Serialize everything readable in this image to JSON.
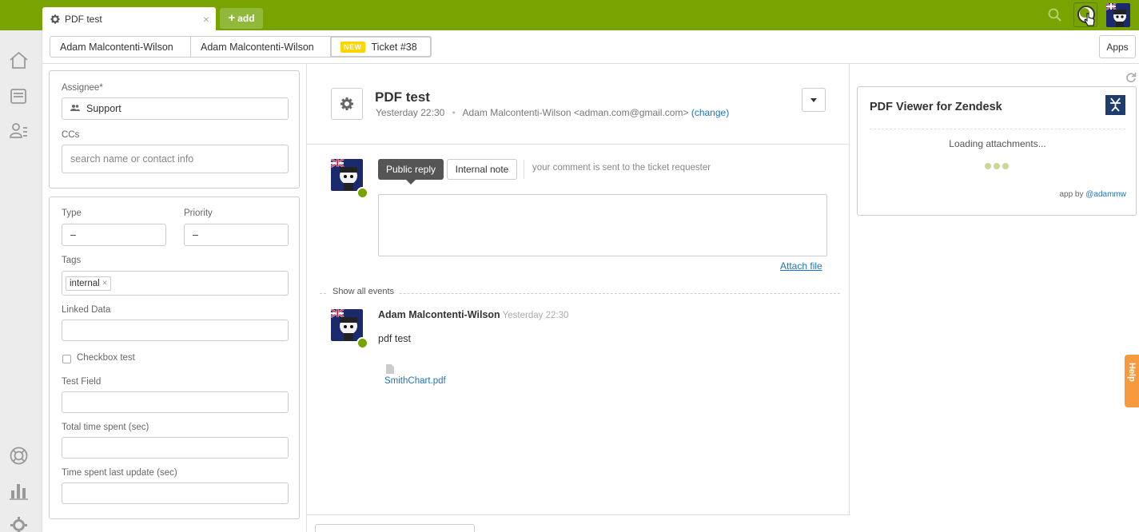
{
  "topbar": {
    "tab_title": "PDF test",
    "tab_close": "×",
    "add_label": "add",
    "add_plus": "+",
    "icons": [
      "search-icon",
      "status-avatar-icon",
      "user-avatar-icon"
    ],
    "color": "#78a300"
  },
  "leftnav": {
    "icons": [
      "home-icon",
      "views-icon",
      "customers-icon",
      "help-center-icon",
      "reporting-icon",
      "admin-gear-icon"
    ]
  },
  "breadcrumbs": {
    "items": [
      "Adam Malcontenti-Wilson",
      "Adam Malcontenti-Wilson"
    ],
    "new_badge": "NEW",
    "ticket": "Ticket #38"
  },
  "apps_button": "Apps",
  "properties": {
    "assignee_label": "Assignee*",
    "assignee_value": "Support",
    "ccs_label": "CCs",
    "ccs_placeholder": "search name or contact info",
    "type_label": "Type",
    "type_value": "–",
    "priority_label": "Priority",
    "priority_value": "–",
    "tags_label": "Tags",
    "tag": "internal",
    "tag_remove": "×",
    "linked_data_label": "Linked Data",
    "checkbox_label": "Checkbox test",
    "test_field_label": "Test Field",
    "total_time_label": "Total time spent (sec)",
    "time_last_label": "Time spent last update (sec)"
  },
  "ticket": {
    "title": "PDF test",
    "time": "Yesterday 22:30",
    "separator": "•",
    "requester": "Adam Malcontenti-Wilson <adman.com@gmail.com>",
    "change": "(change)"
  },
  "composer": {
    "public_reply": "Public reply",
    "internal_note": "Internal note",
    "hint": "your comment is sent to the ticket requester",
    "attach": "Attach file"
  },
  "events": {
    "show_all": "Show all events",
    "author": "Adam Malcontenti-Wilson",
    "time": "Yesterday 22:30",
    "body": "pdf test",
    "attachment": "SmithChart.pdf"
  },
  "app_panel": {
    "title": "PDF Viewer for Zendesk",
    "loading": "Loading attachments...",
    "by": "app by",
    "handle": "@adammw"
  },
  "help_tab": "Help"
}
